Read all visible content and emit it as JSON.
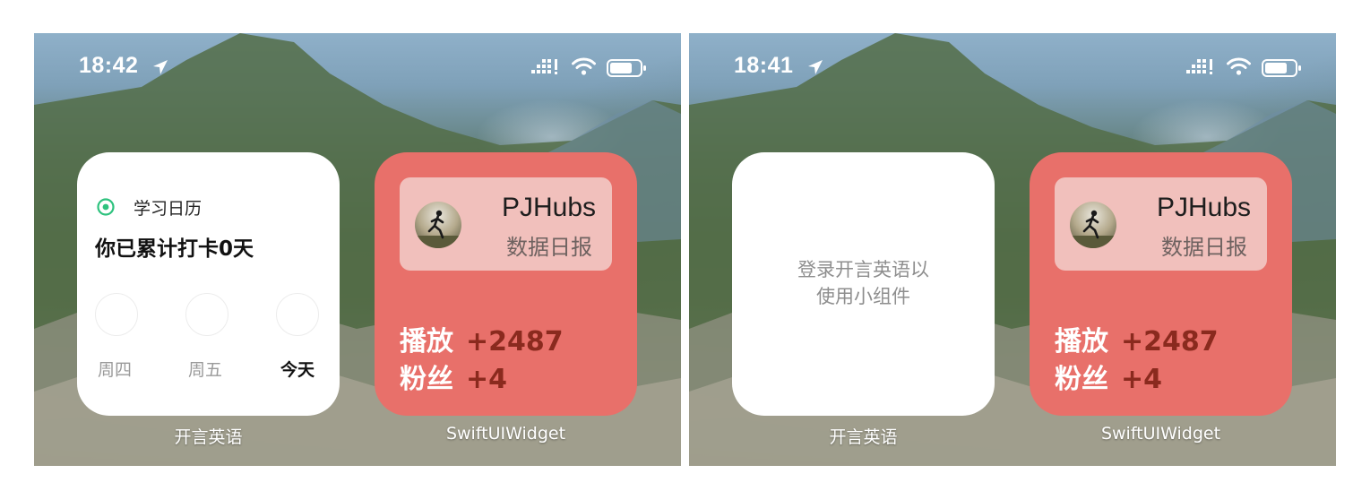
{
  "screens": [
    {
      "status": {
        "time": "18:42"
      },
      "calendar_widget": {
        "title": "学习日历",
        "streak_text": "你已累计打卡0天",
        "days": [
          "周四",
          "周五",
          "今天"
        ]
      },
      "app_label_left": "开言英语",
      "stats_widget": {
        "name": "PJHubs",
        "subtitle": "数据日报",
        "plays_label": "播放",
        "plays_value": "+2487",
        "fans_label": "粉丝",
        "fans_value": "+4"
      },
      "app_label_right": "SwiftUIWidget"
    },
    {
      "status": {
        "time": "18:41"
      },
      "login_widget": {
        "line1": "登录开言英语以",
        "line2": "使用小组件"
      },
      "app_label_left": "开言英语",
      "stats_widget": {
        "name": "PJHubs",
        "subtitle": "数据日报",
        "plays_label": "播放",
        "plays_value": "+2487",
        "fans_label": "粉丝",
        "fans_value": "+4"
      },
      "app_label_right": "SwiftUIWidget"
    }
  ],
  "colors": {
    "stats_widget_bg": "#e8706a",
    "profile_card_bg": "#f1c0bc",
    "stat_value": "#8a2a1e",
    "calendar_icon": "#2ec27e"
  },
  "icons": [
    "location-arrow-icon",
    "cellular-signal-icon",
    "wifi-icon",
    "battery-icon",
    "calendar-target-icon",
    "runner-avatar"
  ]
}
